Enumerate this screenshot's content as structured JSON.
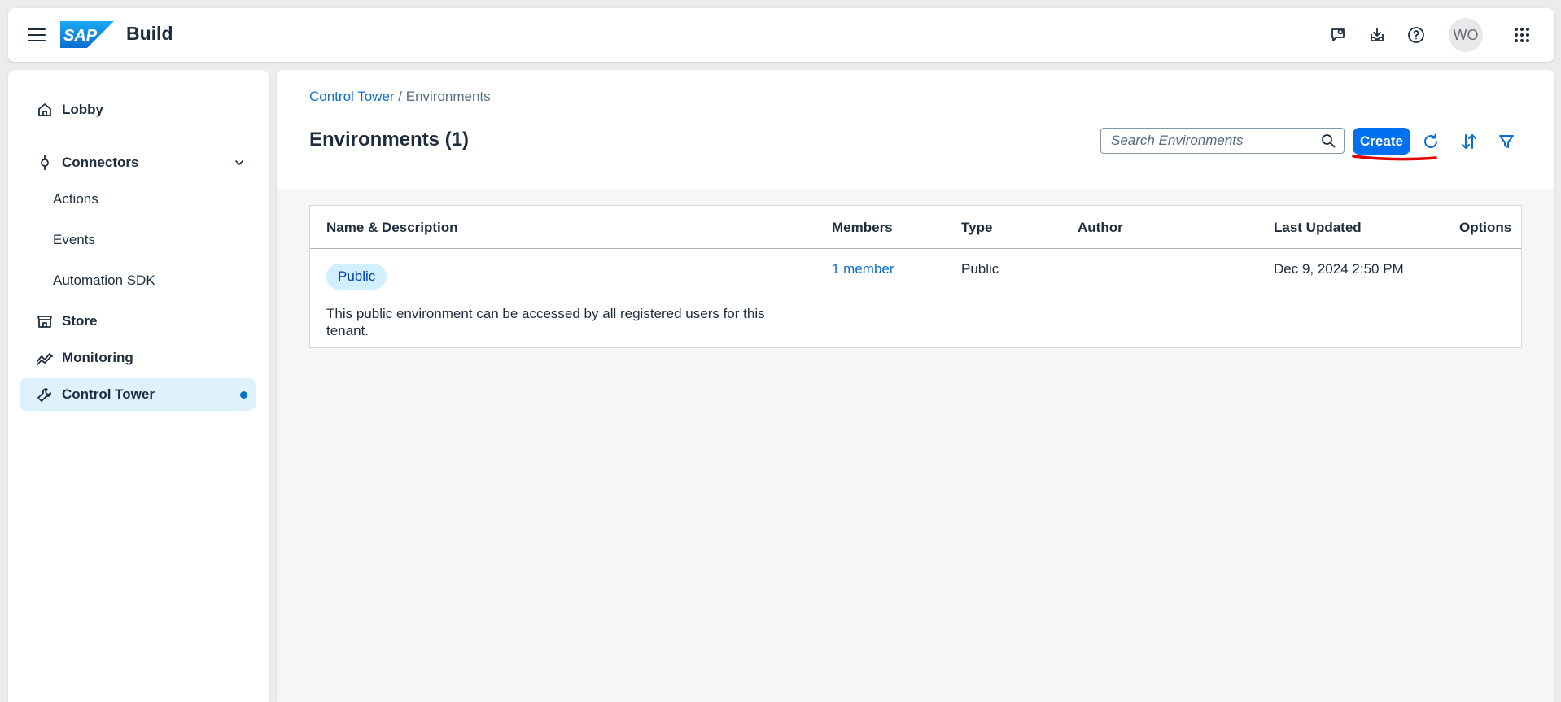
{
  "shell": {
    "logo_text": "SAP",
    "product_name": "Build",
    "avatar_initials": "WO",
    "icons": [
      "feedback-icon",
      "inbox-download-icon",
      "help-icon",
      "product-switch-icon"
    ],
    "logo_color": "#0a6ed1"
  },
  "sidebar": {
    "items": [
      {
        "label": "Lobby",
        "icon": "home-icon"
      },
      {
        "label": "Connectors",
        "icon": "connector-icon",
        "expanded": true
      },
      {
        "label": "Actions"
      },
      {
        "label": "Events"
      },
      {
        "label": "Automation SDK"
      },
      {
        "label": "Store",
        "icon": "store-icon"
      },
      {
        "label": "Monitoring",
        "icon": "monitoring-icon"
      },
      {
        "label": "Control Tower",
        "icon": "wrench-icon",
        "selected": true
      }
    ]
  },
  "breadcrumb": {
    "parent": "Control Tower",
    "separator": " / ",
    "current": "Environments"
  },
  "page": {
    "title": "Environments (1)"
  },
  "toolbar": {
    "search_placeholder": "Search Environments",
    "create_label": "Create"
  },
  "table": {
    "columns": [
      "Name & Description",
      "Members",
      "Type",
      "Author",
      "Last Updated",
      "Options"
    ],
    "rows": [
      {
        "name": "Public",
        "description": "This public environment can be accessed by all registered users for this tenant.",
        "members": "1 member",
        "type": "Public",
        "author": "",
        "last_updated": "Dec 9, 2024 2:50 PM",
        "options": ""
      }
    ]
  },
  "colors": {
    "accent": "#0070f2",
    "link": "#0a6ed1",
    "selected_nav_bg": "#dff1fd",
    "tag_bg": "#d1efff",
    "annotation": "#e00000"
  }
}
